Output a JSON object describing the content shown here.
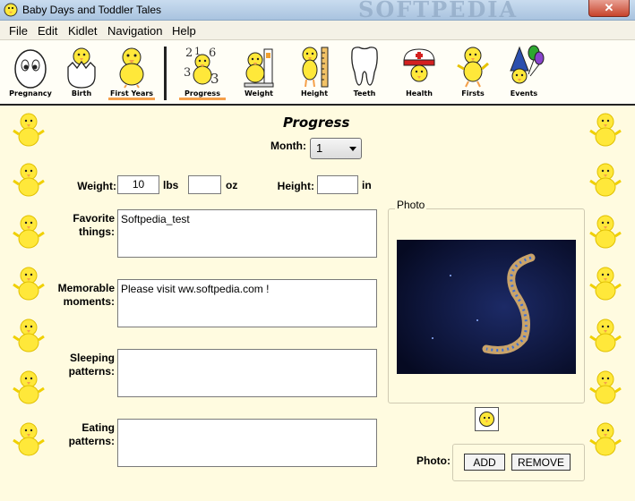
{
  "window": {
    "title": "Baby Days and Toddler Tales",
    "close_label": "✕",
    "watermark": "SOFTPEDIA"
  },
  "menu": [
    "File",
    "Edit",
    "Kidlet",
    "Navigation",
    "Help"
  ],
  "toolbar": {
    "sections": [
      "Pregnancy",
      "Birth",
      "First Years"
    ],
    "tabs": [
      "Progress",
      "Weight",
      "Height",
      "Teeth",
      "Health",
      "Firsts",
      "Events"
    ],
    "active_section": "First Years",
    "active_tab": "Progress"
  },
  "form": {
    "heading": "Progress",
    "month_label": "Month:",
    "month_value": "1",
    "weight_label": "Weight:",
    "weight_lbs": "10",
    "lbs_label": "lbs",
    "weight_oz": "",
    "oz_label": "oz",
    "height_label": "Height:",
    "height_value": "",
    "in_label": "in",
    "favorite_label_1": "Favorite",
    "favorite_label_2": "things:",
    "favorite_value": "Softpedia_test",
    "memorable_label_1": "Memorable",
    "memorable_label_2": "moments:",
    "memorable_value": "Please visit ww.softpedia.com !",
    "sleeping_label_1": "Sleeping",
    "sleeping_label_2": "patterns:",
    "sleeping_value": "",
    "eating_label_1": "Eating",
    "eating_label_2": "patterns:",
    "eating_value": ""
  },
  "photo": {
    "caption": "Photo",
    "label": "Photo:",
    "add_label": "ADD",
    "remove_label": "REMOVE"
  },
  "colors": {
    "chick": "#ffe83a",
    "accent_underline": "#f5a04a",
    "background": "#fffbe0"
  }
}
